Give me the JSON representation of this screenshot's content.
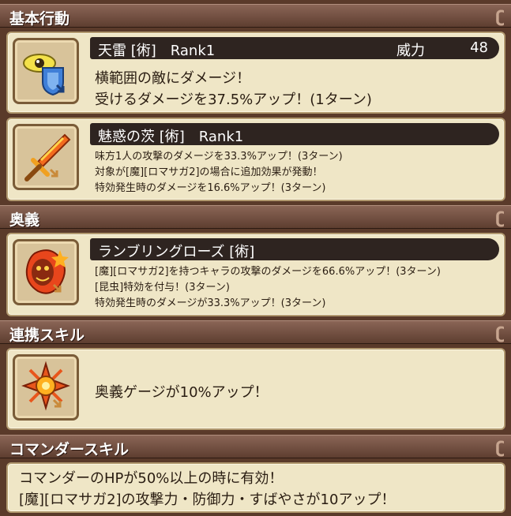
{
  "sections": {
    "basic": "基本行動",
    "ougi": "奥義",
    "link": "連携スキル",
    "commander": "コマンダースキル"
  },
  "swirl_glyph": "ʗ",
  "skill1": {
    "title": "天雷 [術]　Rank1",
    "power_label": "威力",
    "power_value": "48",
    "lines": [
      "横範囲の敵にダメージ！",
      "受けるダメージを37.5%アップ！(1ターン)"
    ]
  },
  "skill2": {
    "title": "魅惑の茨 [術]　Rank1",
    "lines": [
      "味方1人の攻撃のダメージを33.3%アップ！(3ターン)",
      "対象が[魔][ロマサガ2]の場合に追加効果が発動！",
      "特効発生時のダメージを16.6%アップ！(3ターン)"
    ]
  },
  "ougi_skill": {
    "title": "ランブリングローズ [術]",
    "lines": [
      "[魔][ロマサガ2]を持つキャラの攻撃のダメージを66.6%アップ！(3ターン)",
      "[昆虫]特効を付与！(3ターン)",
      "特効発生時のダメージが33.3%アップ！(3ターン)"
    ]
  },
  "link_skill": {
    "text": "奥義ゲージが10%アップ！"
  },
  "commander_skill": {
    "lines": [
      "コマンダーのHPが50%以上の時に有効！",
      "[魔][ロマサガ2]の攻撃力・防御力・すばやさが10アップ！"
    ]
  },
  "icons": {
    "skill1": "eye-shield-icon",
    "skill2": "flaming-sword-icon",
    "ougi": "fire-demon-icon",
    "link": "sun-burst-icon"
  },
  "colors": {
    "section_bar": "#6f4c3e",
    "card_bg": "#efe6c6",
    "title_bar": "#2e2420"
  }
}
